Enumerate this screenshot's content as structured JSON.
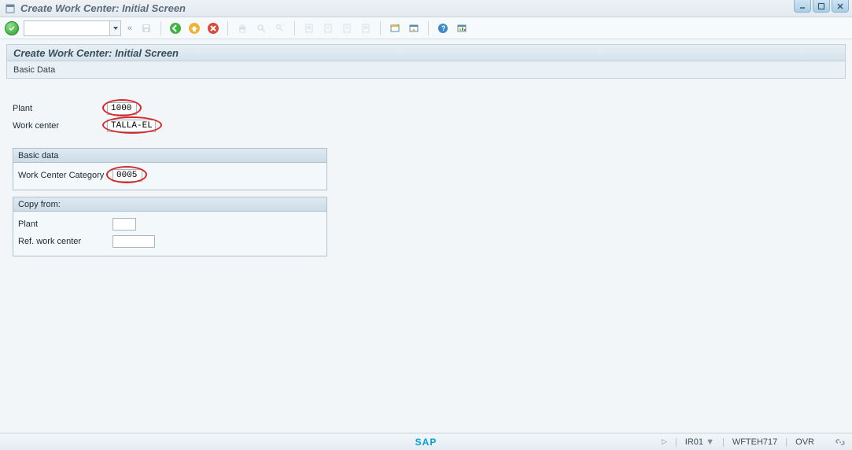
{
  "window": {
    "title": "Create Work Center: Initial Screen"
  },
  "toolbar": {
    "chevrons": "«"
  },
  "screen": {
    "header": "Create Work Center: Initial Screen",
    "tab_basic_data": "Basic Data"
  },
  "fields": {
    "plant_label": "Plant",
    "plant_value": "1000",
    "work_center_label": "Work center",
    "work_center_value": "TALLA-EL"
  },
  "basic_data_group": {
    "title": "Basic data",
    "category_label": "Work Center Category",
    "category_value": "0005"
  },
  "copy_from_group": {
    "title": "Copy from:",
    "plant_label": "Plant",
    "plant_value": "",
    "ref_wc_label": "Ref. work center",
    "ref_wc_value": ""
  },
  "status": {
    "tcode": "IR01",
    "system": "WFTEH717",
    "mode": "OVR"
  }
}
